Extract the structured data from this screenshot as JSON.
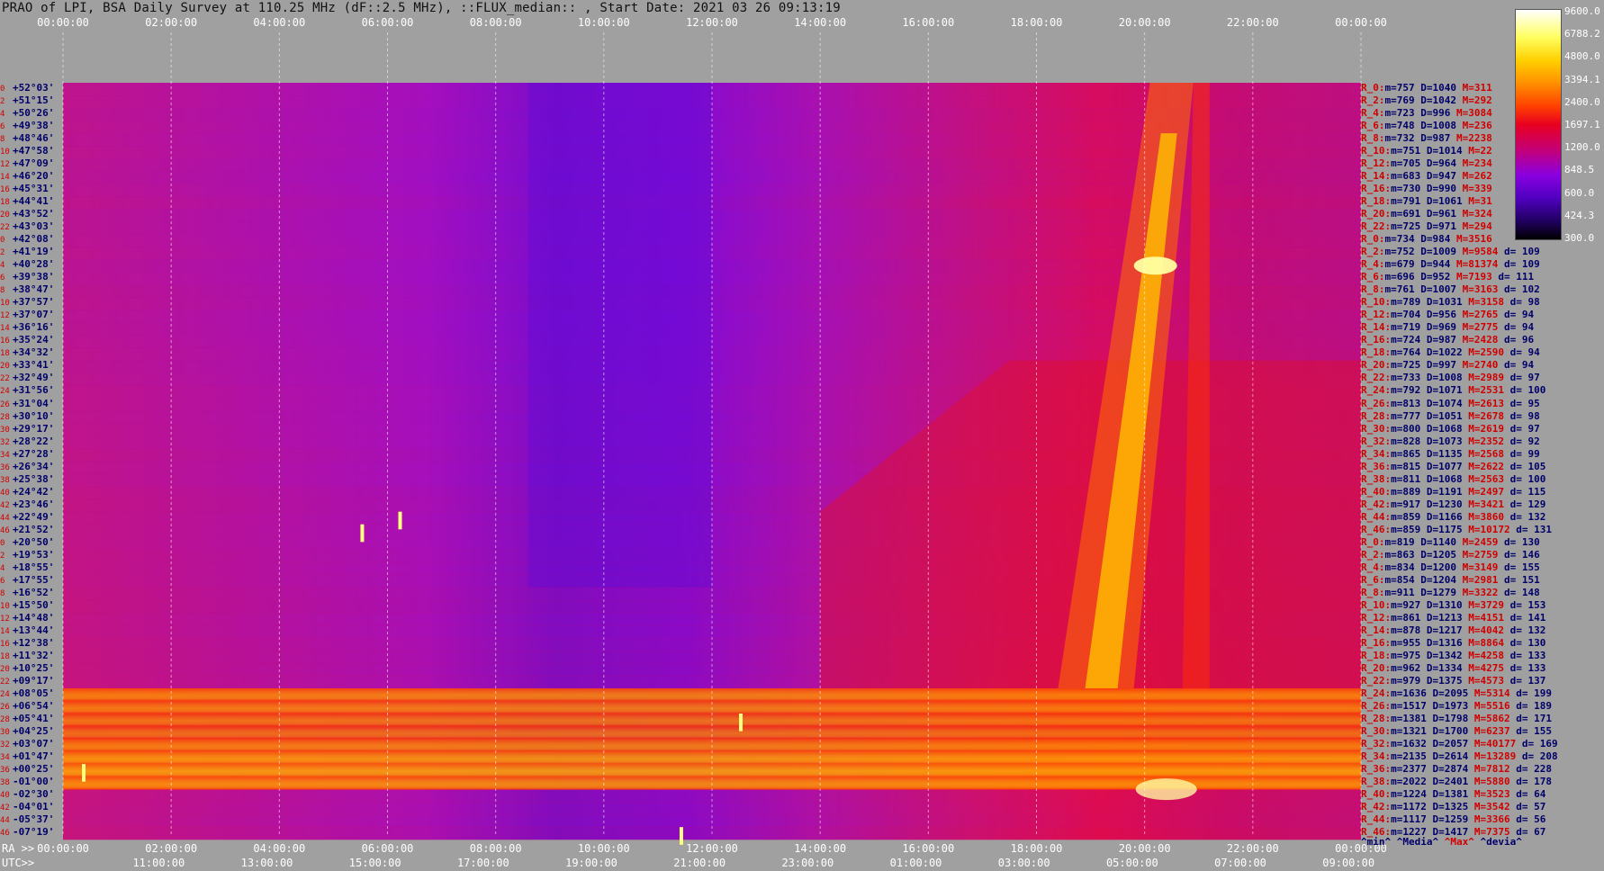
{
  "title": "PRAO of LPI, BSA Daily Survey at 110.25 MHz (dF::2.5 MHz), ::FLUX_median:: , Start Date: 2021 03 26 09:13:19",
  "axes": {
    "top_ticks": [
      "00:00:00",
      "02:00:00",
      "04:00:00",
      "06:00:00",
      "08:00:00",
      "10:00:00",
      "12:00:00",
      "14:00:00",
      "16:00:00",
      "18:00:00",
      "20:00:00",
      "22:00:00",
      "00:00:00"
    ],
    "ra_label": "RA >>",
    "ra_ticks": [
      "00:00:00",
      "02:00:00",
      "04:00:00",
      "06:00:00",
      "08:00:00",
      "10:00:00",
      "12:00:00",
      "14:00:00",
      "16:00:00",
      "18:00:00",
      "20:00:00",
      "22:00:00",
      "00:00:00"
    ],
    "utc_label": "UTC>>",
    "utc_ticks": [
      "11:00:00",
      "13:00:00",
      "15:00:00",
      "17:00:00",
      "19:00:00",
      "21:00:00",
      "23:00:00",
      "01:00:00",
      "03:00:00",
      "05:00:00",
      "07:00:00",
      "09:00:00"
    ]
  },
  "colorbar": {
    "labels": [
      "9600.0",
      "6788.2",
      "4800.0",
      "3394.1",
      "2400.0",
      "1697.1",
      "1200.0",
      "848.5",
      "600.0",
      "424.3",
      "300.0"
    ]
  },
  "stat_legend": {
    "min": "^min^",
    "median": "^Media^",
    "max": "^Max^",
    "dev": "^devia^"
  },
  "chart_data": {
    "type": "heatmap",
    "title": "PRAO of LPI, BSA Daily Survey at 110.25 MHz (dF::2.5 MHz), ::FLUX_median:: , Start Date: 2021 03 26 09:13:19",
    "xlabel": "RA >> / UTC>>",
    "x_range_hours": [
      0,
      24
    ],
    "color_scale": "log",
    "color_range": [
      300.0,
      9600.0
    ],
    "rows": [
      {
        "idx": "0",
        "dec": "+52°03'",
        "r": "R_0:",
        "min": "m=757",
        "med": "D=1040",
        "max": "M=311",
        "dev": ""
      },
      {
        "idx": "2",
        "dec": "+51°15'",
        "r": "R_2:",
        "min": "m=769",
        "med": "D=1042",
        "max": "M=292",
        "dev": ""
      },
      {
        "idx": "4",
        "dec": "+50°26'",
        "r": "R_4:",
        "min": "m=723",
        "med": "D=996",
        "max": "M=3084",
        "dev": ""
      },
      {
        "idx": "6",
        "dec": "+49°38'",
        "r": "R_6:",
        "min": "m=748",
        "med": "D=1008",
        "max": "M=236",
        "dev": ""
      },
      {
        "idx": "8",
        "dec": "+48°46'",
        "r": "R_8:",
        "min": "m=732",
        "med": "D=987",
        "max": "M=2238",
        "dev": ""
      },
      {
        "idx": "10",
        "dec": "+47°58'",
        "r": "R_10:",
        "min": "m=751",
        "med": "D=1014",
        "max": "M=22",
        "dev": ""
      },
      {
        "idx": "12",
        "dec": "+47°09'",
        "r": "R_12:",
        "min": "m=705",
        "med": "D=964",
        "max": "M=234",
        "dev": ""
      },
      {
        "idx": "14",
        "dec": "+46°20'",
        "r": "R_14:",
        "min": "m=683",
        "med": "D=947",
        "max": "M=262",
        "dev": ""
      },
      {
        "idx": "16",
        "dec": "+45°31'",
        "r": "R_16:",
        "min": "m=730",
        "med": "D=990",
        "max": "M=339",
        "dev": ""
      },
      {
        "idx": "18",
        "dec": "+44°41'",
        "r": "R_18:",
        "min": "m=791",
        "med": "D=1061",
        "max": "M=31",
        "dev": ""
      },
      {
        "idx": "20",
        "dec": "+43°52'",
        "r": "R_20:",
        "min": "m=691",
        "med": "D=961",
        "max": "M=324",
        "dev": ""
      },
      {
        "idx": "22",
        "dec": "+43°03'",
        "r": "R_22:",
        "min": "m=725",
        "med": "D=971",
        "max": "M=294",
        "dev": ""
      },
      {
        "idx": "0",
        "dec": "+42°08'",
        "r": "R_0:",
        "min": "m=734",
        "med": "D=984",
        "max": "M=3516",
        "dev": ""
      },
      {
        "idx": "2",
        "dec": "+41°19'",
        "r": "R_2:",
        "min": "m=752",
        "med": "D=1009",
        "max": "M=9584",
        "dev": "d= 109"
      },
      {
        "idx": "4",
        "dec": "+40°28'",
        "r": "R_4:",
        "min": "m=679",
        "med": "D=944",
        "max": "M=81374",
        "dev": "d= 109"
      },
      {
        "idx": "6",
        "dec": "+39°38'",
        "r": "R_6:",
        "min": "m=696",
        "med": "D=952",
        "max": "M=7193",
        "dev": "d= 111"
      },
      {
        "idx": "8",
        "dec": "+38°47'",
        "r": "R_8:",
        "min": "m=761",
        "med": "D=1007",
        "max": "M=3163",
        "dev": "d= 102"
      },
      {
        "idx": "10",
        "dec": "+37°57'",
        "r": "R_10:",
        "min": "m=789",
        "med": "D=1031",
        "max": "M=3158",
        "dev": "d= 98"
      },
      {
        "idx": "12",
        "dec": "+37°07'",
        "r": "R_12:",
        "min": "m=704",
        "med": "D=956",
        "max": "M=2765",
        "dev": "d= 94"
      },
      {
        "idx": "14",
        "dec": "+36°16'",
        "r": "R_14:",
        "min": "m=719",
        "med": "D=969",
        "max": "M=2775",
        "dev": "d= 94"
      },
      {
        "idx": "16",
        "dec": "+35°24'",
        "r": "R_16:",
        "min": "m=724",
        "med": "D=987",
        "max": "M=2428",
        "dev": "d= 96"
      },
      {
        "idx": "18",
        "dec": "+34°32'",
        "r": "R_18:",
        "min": "m=764",
        "med": "D=1022",
        "max": "M=2590",
        "dev": "d= 94"
      },
      {
        "idx": "20",
        "dec": "+33°41'",
        "r": "R_20:",
        "min": "m=725",
        "med": "D=997",
        "max": "M=2740",
        "dev": "d= 94"
      },
      {
        "idx": "22",
        "dec": "+32°49'",
        "r": "R_22:",
        "min": "m=733",
        "med": "D=1008",
        "max": "M=2989",
        "dev": "d= 97"
      },
      {
        "idx": "24",
        "dec": "+31°56'",
        "r": "R_24:",
        "min": "m=792",
        "med": "D=1071",
        "max": "M=2531",
        "dev": "d= 100"
      },
      {
        "idx": "26",
        "dec": "+31°04'",
        "r": "R_26:",
        "min": "m=813",
        "med": "D=1074",
        "max": "M=2613",
        "dev": "d= 95"
      },
      {
        "idx": "28",
        "dec": "+30°10'",
        "r": "R_28:",
        "min": "m=777",
        "med": "D=1051",
        "max": "M=2678",
        "dev": "d= 98"
      },
      {
        "idx": "30",
        "dec": "+29°17'",
        "r": "R_30:",
        "min": "m=800",
        "med": "D=1068",
        "max": "M=2619",
        "dev": "d= 97"
      },
      {
        "idx": "32",
        "dec": "+28°22'",
        "r": "R_32:",
        "min": "m=828",
        "med": "D=1073",
        "max": "M=2352",
        "dev": "d= 92"
      },
      {
        "idx": "34",
        "dec": "+27°28'",
        "r": "R_34:",
        "min": "m=865",
        "med": "D=1135",
        "max": "M=2568",
        "dev": "d= 99"
      },
      {
        "idx": "36",
        "dec": "+26°34'",
        "r": "R_36:",
        "min": "m=815",
        "med": "D=1077",
        "max": "M=2622",
        "dev": "d= 105"
      },
      {
        "idx": "38",
        "dec": "+25°38'",
        "r": "R_38:",
        "min": "m=811",
        "med": "D=1068",
        "max": "M=2563",
        "dev": "d= 100"
      },
      {
        "idx": "40",
        "dec": "+24°42'",
        "r": "R_40:",
        "min": "m=889",
        "med": "D=1191",
        "max": "M=2497",
        "dev": "d= 115"
      },
      {
        "idx": "42",
        "dec": "+23°46'",
        "r": "R_42:",
        "min": "m=917",
        "med": "D=1230",
        "max": "M=3421",
        "dev": "d= 129"
      },
      {
        "idx": "44",
        "dec": "+22°49'",
        "r": "R_44:",
        "min": "m=859",
        "med": "D=1166",
        "max": "M=3860",
        "dev": "d= 132"
      },
      {
        "idx": "46",
        "dec": "+21°52'",
        "r": "R_46:",
        "min": "m=859",
        "med": "D=1175",
        "max": "M=10172",
        "dev": "d= 131"
      },
      {
        "idx": "0",
        "dec": "+20°50'",
        "r": "R_0:",
        "min": "m=819",
        "med": "D=1140",
        "max": "M=2459",
        "dev": "d= 130"
      },
      {
        "idx": "2",
        "dec": "+19°53'",
        "r": "R_2:",
        "min": "m=863",
        "med": "D=1205",
        "max": "M=2759",
        "dev": "d= 146"
      },
      {
        "idx": "4",
        "dec": "+18°55'",
        "r": "R_4:",
        "min": "m=834",
        "med": "D=1200",
        "max": "M=3149",
        "dev": "d= 155"
      },
      {
        "idx": "6",
        "dec": "+17°55'",
        "r": "R_6:",
        "min": "m=854",
        "med": "D=1204",
        "max": "M=2981",
        "dev": "d= 151"
      },
      {
        "idx": "8",
        "dec": "+16°52'",
        "r": "R_8:",
        "min": "m=911",
        "med": "D=1279",
        "max": "M=3322",
        "dev": "d= 148"
      },
      {
        "idx": "10",
        "dec": "+15°50'",
        "r": "R_10:",
        "min": "m=927",
        "med": "D=1310",
        "max": "M=3729",
        "dev": "d= 153"
      },
      {
        "idx": "12",
        "dec": "+14°48'",
        "r": "R_12:",
        "min": "m=861",
        "med": "D=1213",
        "max": "M=4151",
        "dev": "d= 141"
      },
      {
        "idx": "14",
        "dec": "+13°44'",
        "r": "R_14:",
        "min": "m=878",
        "med": "D=1217",
        "max": "M=4042",
        "dev": "d= 132"
      },
      {
        "idx": "16",
        "dec": "+12°38'",
        "r": "R_16:",
        "min": "m=955",
        "med": "D=1316",
        "max": "M=8864",
        "dev": "d= 130"
      },
      {
        "idx": "18",
        "dec": "+11°32'",
        "r": "R_18:",
        "min": "m=975",
        "med": "D=1342",
        "max": "M=4258",
        "dev": "d= 133"
      },
      {
        "idx": "20",
        "dec": "+10°25'",
        "r": "R_20:",
        "min": "m=962",
        "med": "D=1334",
        "max": "M=4275",
        "dev": "d= 133"
      },
      {
        "idx": "22",
        "dec": "+09°17'",
        "r": "R_22:",
        "min": "m=979",
        "med": "D=1375",
        "max": "M=4573",
        "dev": "d= 137"
      },
      {
        "idx": "24",
        "dec": "+08°05'",
        "r": "R_24:",
        "min": "m=1636",
        "med": "D=2095",
        "max": "M=5314",
        "dev": "d= 199"
      },
      {
        "idx": "26",
        "dec": "+06°54'",
        "r": "R_26:",
        "min": "m=1517",
        "med": "D=1973",
        "max": "M=5516",
        "dev": "d= 189"
      },
      {
        "idx": "28",
        "dec": "+05°41'",
        "r": "R_28:",
        "min": "m=1381",
        "med": "D=1798",
        "max": "M=5862",
        "dev": "d= 171"
      },
      {
        "idx": "30",
        "dec": "+04°25'",
        "r": "R_30:",
        "min": "m=1321",
        "med": "D=1700",
        "max": "M=6237",
        "dev": "d= 155"
      },
      {
        "idx": "32",
        "dec": "+03°07'",
        "r": "R_32:",
        "min": "m=1632",
        "med": "D=2057",
        "max": "M=40177",
        "dev": "d= 169"
      },
      {
        "idx": "34",
        "dec": "+01°47'",
        "r": "R_34:",
        "min": "m=2135",
        "med": "D=2614",
        "max": "M=13289",
        "dev": "d= 208"
      },
      {
        "idx": "36",
        "dec": "+00°25'",
        "r": "R_36:",
        "min": "m=2377",
        "med": "D=2874",
        "max": "M=7812",
        "dev": "d= 228"
      },
      {
        "idx": "38",
        "dec": "-01°00'",
        "r": "R_38:",
        "min": "m=2022",
        "med": "D=2401",
        "max": "M=5880",
        "dev": "d= 178"
      },
      {
        "idx": "40",
        "dec": "-02°30'",
        "r": "R_40:",
        "min": "m=1224",
        "med": "D=1381",
        "max": "M=3523",
        "dev": "d= 64"
      },
      {
        "idx": "42",
        "dec": "-04°01'",
        "r": "R_42:",
        "min": "m=1172",
        "med": "D=1325",
        "max": "M=3542",
        "dev": "d= 57"
      },
      {
        "idx": "44",
        "dec": "-05°37'",
        "r": "R_44:",
        "min": "m=1117",
        "med": "D=1259",
        "max": "M=3366",
        "dev": "d= 56"
      },
      {
        "idx": "46",
        "dec": "-07°19'",
        "r": "R_46:",
        "min": "m=1227",
        "med": "D=1417",
        "max": "M=7375",
        "dev": "d= 67"
      }
    ]
  }
}
